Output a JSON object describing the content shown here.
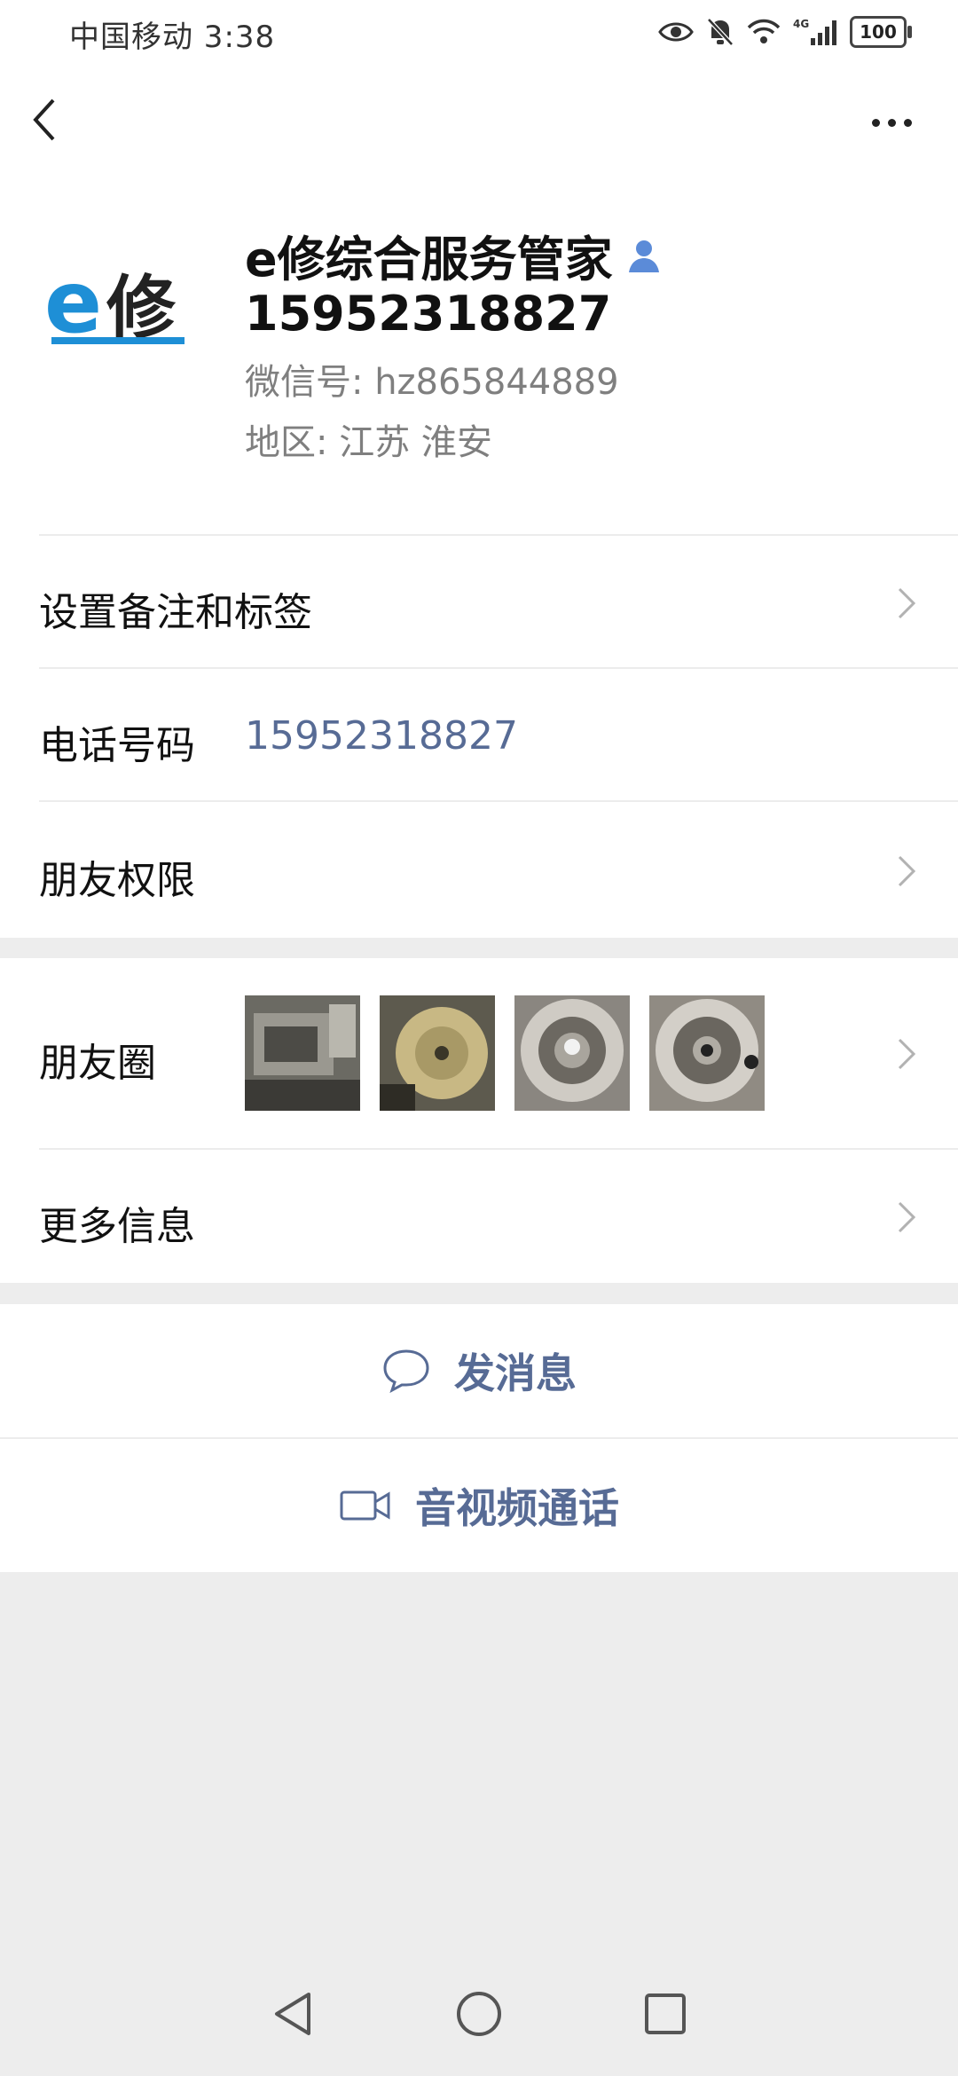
{
  "status_bar": {
    "carrier_time": "中国移动 3:38",
    "battery": "100",
    "icons": [
      "eye-icon",
      "bell-off-icon",
      "wifi-icon",
      "4g-signal-icon",
      "battery-icon"
    ]
  },
  "header": {
    "back_icon": "back-arrow-icon",
    "more_icon": "more-dots-icon"
  },
  "profile": {
    "name": "e修综合服务管家",
    "name_line2": "15952318827",
    "wechat_id": "微信号: hz865844889",
    "region": "地区: 江苏  淮安",
    "avatar_text": "e修"
  },
  "rows": {
    "remark": "设置备注和标签",
    "phone_label": "电话号码",
    "phone_value": "15952318827",
    "permissions": "朋友权限",
    "moments": "朋友圈",
    "more_info": "更多信息"
  },
  "actions": {
    "message": "发消息",
    "call": "音视频通话"
  },
  "colors": {
    "link": "#576b95",
    "avatar_blue": "#1e8fd6",
    "background": "#ededed"
  }
}
